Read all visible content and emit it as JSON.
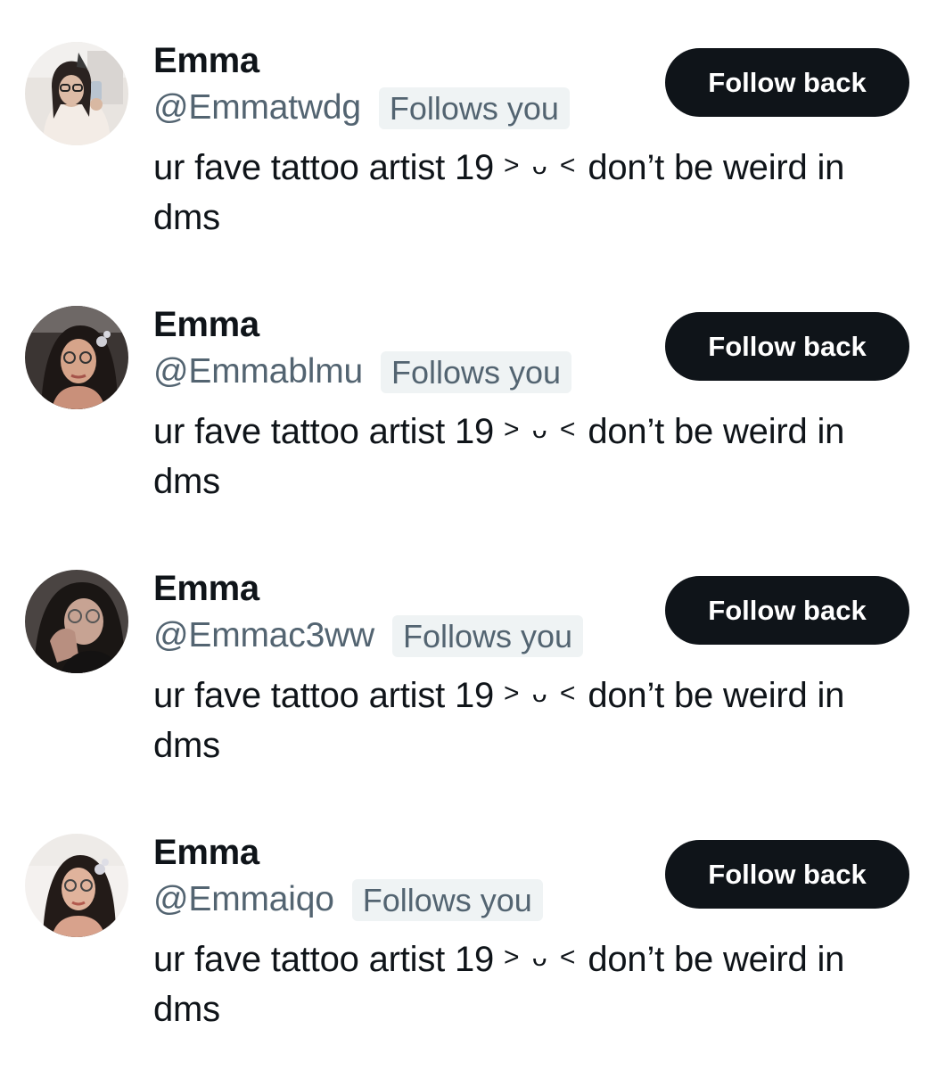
{
  "users": [
    {
      "display_name": "Emma",
      "handle": "@Emmatwdg",
      "follows_badge": "Follows you",
      "bio_before": "ur fave tattoo artist 19",
      "bio_emote": "> ᴗ <",
      "bio_after": "don’t be weird in dms",
      "button_label": "Follow back"
    },
    {
      "display_name": "Emma",
      "handle": "@Emmablmu",
      "follows_badge": "Follows you",
      "bio_before": "ur fave tattoo artist 19",
      "bio_emote": "> ᴗ <",
      "bio_after": "don’t be weird in dms",
      "button_label": "Follow back"
    },
    {
      "display_name": "Emma",
      "handle": "@Emmac3ww",
      "follows_badge": "Follows you",
      "bio_before": "ur fave tattoo artist 19",
      "bio_emote": "> ᴗ <",
      "bio_after": "don’t be weird in dms",
      "button_label": "Follow back"
    },
    {
      "display_name": "Emma",
      "handle": "@Emmaiqo",
      "follows_badge": "Follows you",
      "bio_before": "ur fave tattoo artist 19",
      "bio_emote": "> ᴗ <",
      "bio_after": "don’t be weird in dms",
      "button_label": "Follow back"
    }
  ],
  "colors": {
    "text_primary": "#0f1419",
    "text_secondary": "#536471",
    "badge_bg": "#eff3f4",
    "button_bg": "#0f1419",
    "button_text": "#ffffff"
  }
}
